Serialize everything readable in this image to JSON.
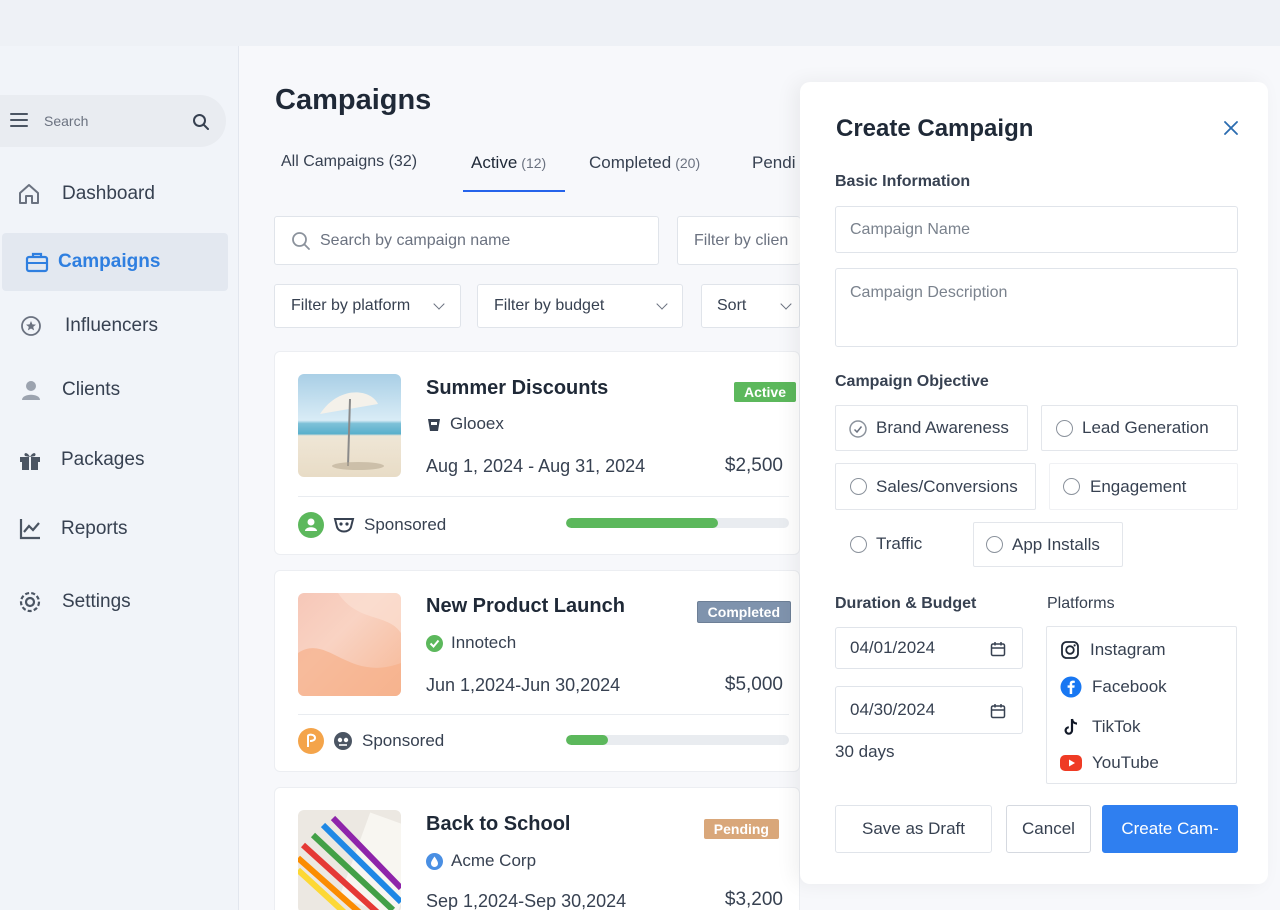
{
  "sidebar": {
    "search_placeholder": "Search",
    "items": [
      {
        "label": "Dashboard",
        "icon": "home-icon"
      },
      {
        "label": "Campaigns",
        "icon": "briefcase-icon",
        "active": true
      },
      {
        "label": "Influencers",
        "icon": "star-icon"
      },
      {
        "label": "Clients",
        "icon": "user-icon"
      },
      {
        "label": "Packages",
        "icon": "gift-icon"
      },
      {
        "label": "Reports",
        "icon": "chart-icon"
      },
      {
        "label": "Settings",
        "icon": "gear-icon"
      }
    ]
  },
  "main": {
    "title": "Campaigns",
    "tabs": [
      {
        "label": "All Campaigns (32)",
        "count": ""
      },
      {
        "label": "Active",
        "count": "(12)"
      },
      {
        "label": "Completed",
        "count": "(20)"
      },
      {
        "label": "Pendi",
        "count": ""
      }
    ],
    "search_placeholder": "Search by campaign name",
    "filter_client": "Filter by clien",
    "filter_platform": "Filter by platform",
    "filter_budget": "Filter by budget",
    "sort": "Sort"
  },
  "campaigns": [
    {
      "title": "Summer Discounts",
      "client": "Glooex",
      "dates": "Aug 1, 2024 - Aug 31, 2024",
      "budget": "$2,500",
      "status": "Active",
      "status_color": "#5cb85c",
      "tag": "Sponsored",
      "progress": 0.68
    },
    {
      "title": "New Product Launch",
      "client": "Innotech",
      "dates": "Jun 1,2024-Jun 30,2024",
      "budget": "$5,000",
      "status": "Completed",
      "status_color": "#7f93ad",
      "tag": "Sponsored",
      "progress": 0.19
    },
    {
      "title": "Back to School",
      "client": "Acme Corp",
      "dates": "Sep 1,2024-Sep 30,2024",
      "budget": "$3,200",
      "status": "Pending",
      "status_color": "#d9a77a"
    }
  ],
  "panel": {
    "title": "Create Campaign",
    "basic_info": "Basic Information",
    "name_placeholder": "Campaign Name",
    "desc_placeholder": "Campaign Description",
    "objective_label": "Campaign Objective",
    "objectives": [
      "Brand Awareness",
      "Lead Generation",
      "Sales/Conversions",
      "Engagement",
      "Traffic",
      "App Installs"
    ],
    "duration_label": "Duration & Budget",
    "start_date": "04/01/2024",
    "end_date": "04/30/2024",
    "days": "30 days",
    "platforms_label": "Platforms",
    "platforms": [
      "Instagram",
      "Facebook",
      "TikTok",
      "YouTube"
    ],
    "save_draft": "Save as Draft",
    "cancel": "Cancel",
    "create": "Create Cam-"
  },
  "colors": {
    "accent": "#2f7ff0",
    "active_nav": "#2f7fe0",
    "progress": "#5cb85c"
  }
}
